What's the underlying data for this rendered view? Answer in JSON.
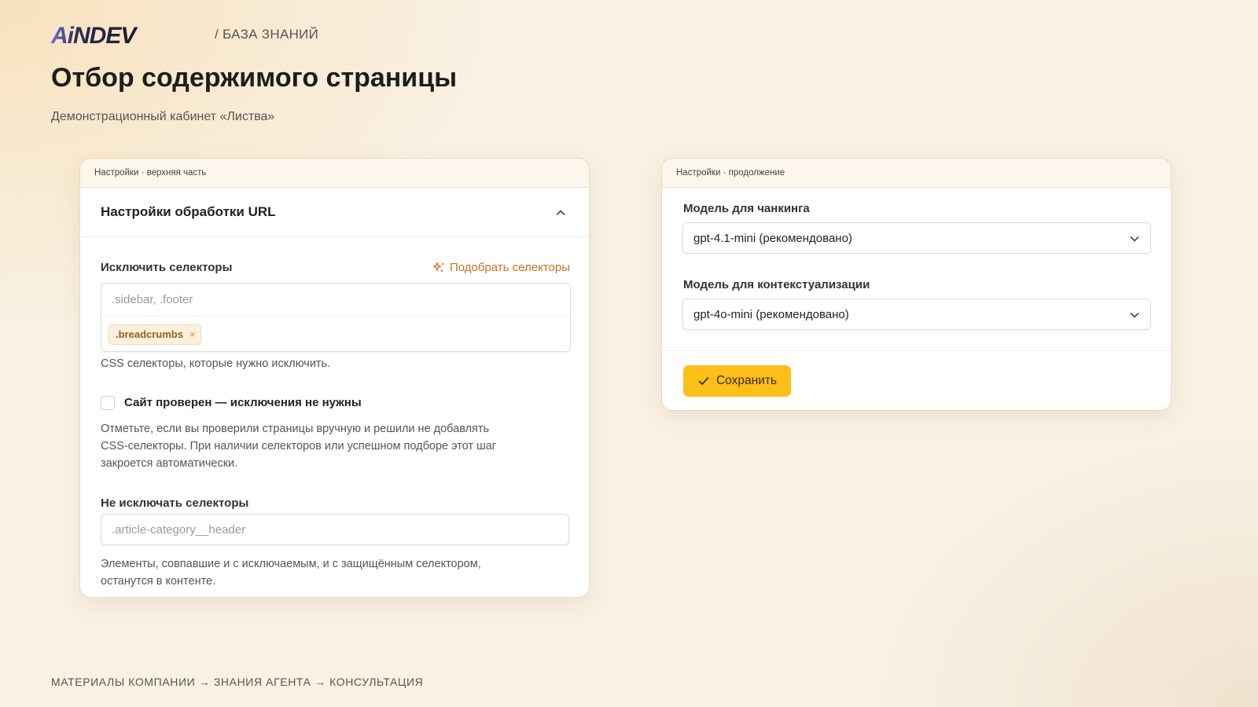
{
  "brand": {
    "logo_text": "AiNDEV",
    "accent": "#6b5bd6"
  },
  "breadcrumb": "/ БАЗА ЗНАНИЙ",
  "page": {
    "title": "Отбор содержимого страницы",
    "subtitle": "Демонстрационный кабинет «Листва»"
  },
  "left_card": {
    "bar_label": "Настройки · верхняя часть",
    "section_title": "Настройки обработки URL",
    "exclude": {
      "label": "Исключить селекторы",
      "pick_button": "Подобрать селекторы",
      "placeholder": ".sidebar, .footer",
      "chips": [
        ".breadcrumbs"
      ],
      "helper": "CSS селекторы, которые нужно исключить."
    },
    "checkbox": {
      "label": "Сайт проверен — исключения не нужны",
      "checked": false,
      "helper_lines": [
        "Отметьте, если вы проверили страницы вручную и решили не добавлять",
        "CSS-селекторы. При наличии селекторов или успешном подборе этот шаг",
        "закроется автоматически."
      ]
    },
    "keep": {
      "label": "Не исключать селекторы",
      "placeholder": ".article-category__header",
      "helper_lines": [
        "Элементы, совпавшие и с исключаемым, и с защищённым селектором,",
        "останутся в контенте."
      ]
    }
  },
  "right_card": {
    "bar_label": "Настройки · продолжение",
    "chunking": {
      "label": "Модель для чанкинга",
      "value": "gpt-4.1-mini (рекомендовано)"
    },
    "context": {
      "label": "Модель для контекстуализации",
      "value": "gpt-4o-mini (рекомендовано)"
    },
    "save_button": "Сохранить"
  },
  "footer": "МАТЕРИАЛЫ КОМПАНИИ → ЗНАНИЯ АГЕНТА → КОНСУЛЬТАЦИЯ",
  "colors": {
    "accent_orange": "#d0701f",
    "save_yellow": "#fcbf18"
  },
  "icons": [
    "sparkle-icon",
    "chevron-up-icon",
    "chevron-down-icon",
    "check-icon",
    "close-icon"
  ]
}
